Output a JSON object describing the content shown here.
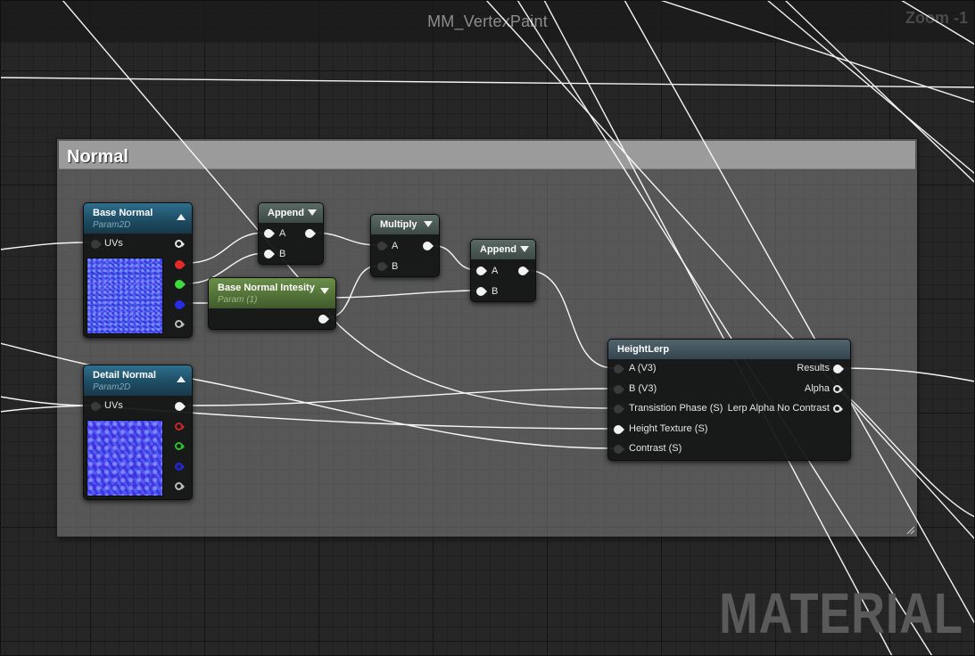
{
  "graph": {
    "title": "MM_VertexPaint",
    "zoom_label": "Zoom -1",
    "watermark": "MATERIAL"
  },
  "comment_box": {
    "title": "Normal"
  },
  "nodes": {
    "base_normal": {
      "title": "Base Normal",
      "subtitle": "Param2D",
      "input_label": "UVs"
    },
    "detail_normal": {
      "title": "Detail Normal",
      "subtitle": "Param2D",
      "input_label": "UVs"
    },
    "append_1": {
      "title": "Append",
      "inputs": [
        "A",
        "B"
      ]
    },
    "base_normal_intensity": {
      "title": "Base Normal Intesity",
      "subtitle": "Param (1)"
    },
    "multiply": {
      "title": "Multiply",
      "inputs": [
        "A",
        "B"
      ]
    },
    "append_2": {
      "title": "Append",
      "inputs": [
        "A",
        "B"
      ]
    },
    "height_lerp": {
      "title": "HeightLerp",
      "inputs": [
        "A (V3)",
        "B (V3)",
        "Transistion Phase (S)",
        "Height Texture (S)",
        "Contrast (S)"
      ],
      "outputs": [
        "Results",
        "Alpha",
        "Lerp Alpha No Contrast"
      ]
    }
  },
  "colors": {
    "graph_background": "#262626",
    "comment_box": "#808080",
    "texture_param_header": "#1d4a60",
    "scalar_param_header": "#4d6b34",
    "math_node_header": "#3d4a45",
    "pin_red": "#e52a2a",
    "pin_green": "#3ddc3d",
    "pin_blue": "#2b2bea",
    "wire": "#ffffff"
  }
}
